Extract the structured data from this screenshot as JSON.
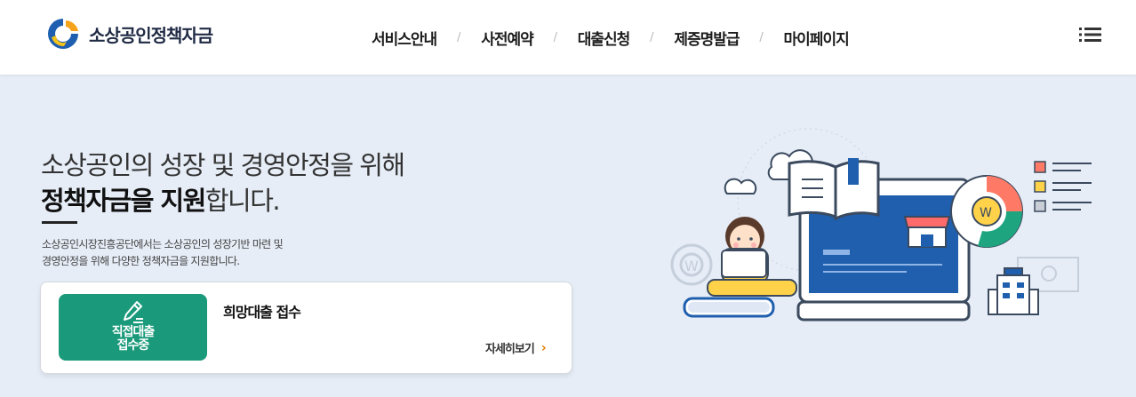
{
  "header": {
    "logo_text": "소상공인정책자금",
    "nav": [
      {
        "label": "서비스안내"
      },
      {
        "label": "사전예약"
      },
      {
        "label": "대출신청"
      },
      {
        "label": "제증명발급"
      },
      {
        "label": "마이페이지"
      }
    ],
    "nav_separator": "/",
    "menu_icon": "hamburger-menu-icon"
  },
  "hero": {
    "title_line1": "소상공인의 성장 및 경영안정을 위해",
    "title_line2_bold": "정책자금을 지원",
    "title_line2_rest": "합니다.",
    "desc_line1": "소상공인시장진흥공단에서는 소상공인의 성장기반 마련 및",
    "desc_line2": "경영안정을 위해 다양한 정책자금을 지원합니다."
  },
  "card": {
    "badge_icon": "pencil-icon",
    "badge_text": "직접대출\n접수중",
    "title": "희망대출 접수",
    "more_label": "자세히보기",
    "more_icon": "chevron-right-icon"
  },
  "colors": {
    "background": "#e6edf7",
    "badge_green": "#1a9a7a",
    "accent_orange": "#e07b00",
    "screen_blue": "#1f5fae"
  }
}
